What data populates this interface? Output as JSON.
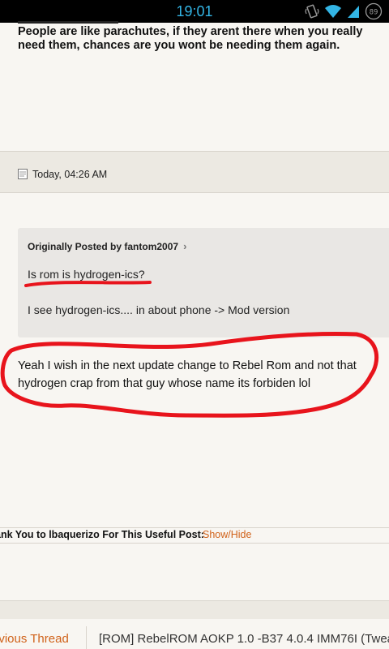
{
  "status_bar": {
    "time": "19:01",
    "battery_level": "89",
    "icons": [
      "vibrate-icon",
      "wifi-icon",
      "signal-icon",
      "battery-icon"
    ]
  },
  "signature": {
    "text": "People are like parachutes, if they arent there when you really need them, chances are you wont be needing them again."
  },
  "post": {
    "date": "Today, 04:26 AM",
    "quote": {
      "attribution": "Originally Posted by fantom2007",
      "line1": "Is rom is hydrogen-ics?",
      "line2": "I see hydrogen-ics.... in about phone -> Mod version"
    },
    "reply": "Yeah I wish in the next update change to Rebel Rom and not that hydrogen crap from that guy whose name its forbiden lol"
  },
  "thanks": {
    "text": "ank You to lbaquerizo For This Useful Post:",
    "toggle_label": "Show/Hide"
  },
  "navigation": {
    "previous_label": "evious Thread",
    "thread_title": "[ROM] RebelROM AOKP 1.0 -B37 4.0.4 IMM76I (Twea"
  },
  "colors": {
    "status_accent": "#33b5e5",
    "link": "#d0621a",
    "annotation": "#e8141c"
  }
}
